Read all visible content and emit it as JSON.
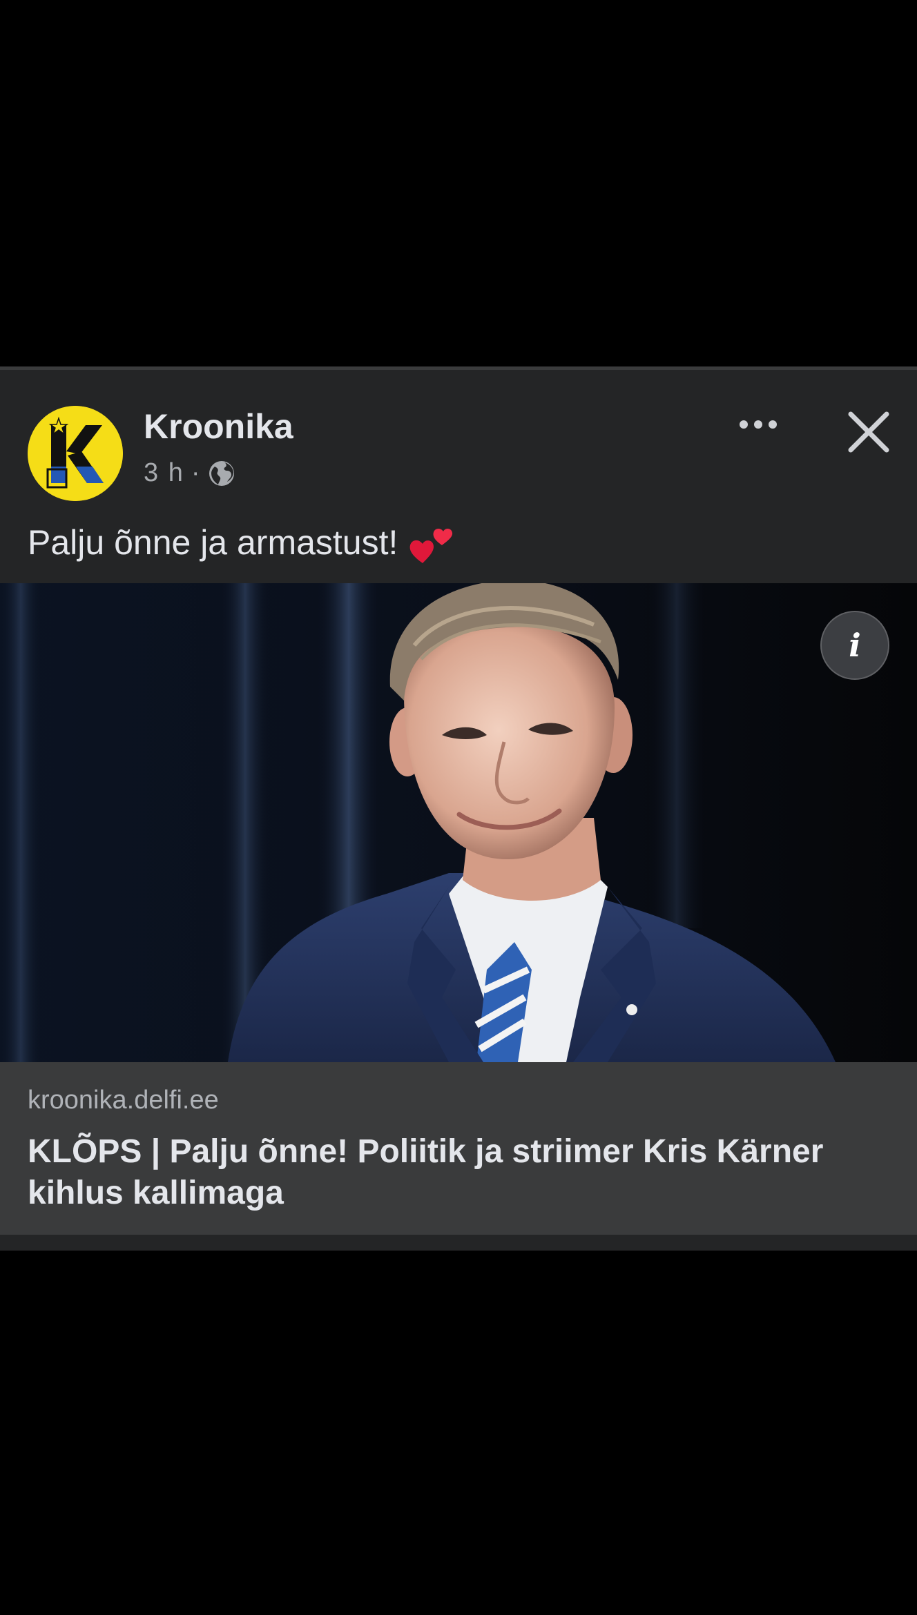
{
  "post": {
    "page_name": "Kroonika",
    "time": "3 h",
    "separator": "·",
    "privacy_icon": "globe-icon",
    "caption": "Palju õnne ja armastust!",
    "caption_emoji": "two-hearts-emoji",
    "avatar_logo_letter": "K"
  },
  "actions": {
    "more_icon": "more-dots-icon",
    "close_icon": "close-icon",
    "info_icon": "info-icon",
    "info_glyph": "i"
  },
  "link_preview": {
    "domain": "kroonika.delfi.ee",
    "headline": "KLÕPS | Palju õnne! Poliitik ja striimer Kris Kärner kihlus kallimaga"
  },
  "colors": {
    "background": "#000000",
    "card": "#242526",
    "link_box": "#3a3b3c",
    "text_primary": "#e4e6eb",
    "text_secondary": "#b0b3b8",
    "logo_yellow": "#f5dd17"
  }
}
